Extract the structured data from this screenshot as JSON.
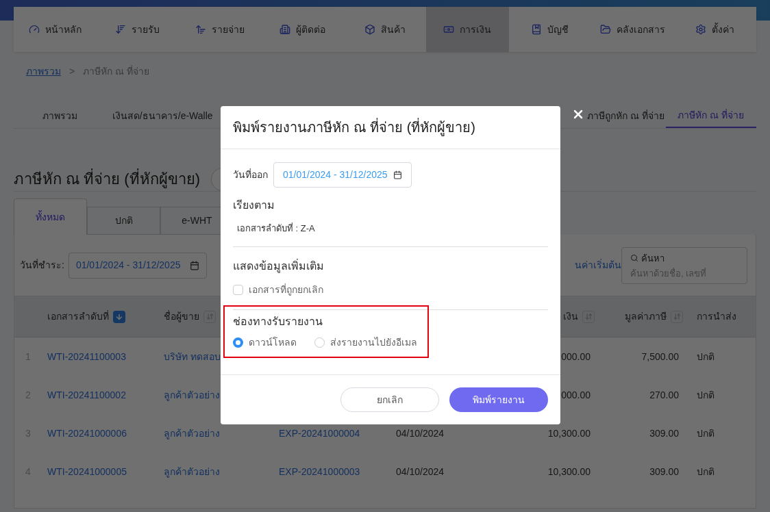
{
  "top_nav": [
    {
      "label": "หน้าหลัก",
      "selected": false
    },
    {
      "label": "รายรับ",
      "selected": false
    },
    {
      "label": "รายจ่าย",
      "selected": false
    },
    {
      "label": "ผู้ติดต่อ",
      "selected": false
    },
    {
      "label": "สินค้า",
      "selected": false
    },
    {
      "label": "การเงิน",
      "selected": true
    },
    {
      "label": "บัญชี",
      "selected": false
    },
    {
      "label": "คลังเอกสาร",
      "selected": false
    },
    {
      "label": "ตั้งค่า",
      "selected": false
    }
  ],
  "breadcrumb": {
    "link": "ภาพรวม",
    "separator": ">",
    "current": "ภาษีหัก ณ ที่จ่าย"
  },
  "sub_tabs": [
    {
      "label": "ภาพรวม",
      "selected": false
    },
    {
      "label": "เงินสด/ธนาคาร/e-Walle",
      "selected": false
    },
    {
      "label": "ภาษีถูกหัก ณ ที่จ่าย",
      "selected": false
    },
    {
      "label": "ภาษีหัก ณ ที่จ่าย",
      "selected": true
    }
  ],
  "page_title": "ภาษีหัก ณ ที่จ่าย (ที่หักผู้ขาย)",
  "card_tabs": [
    {
      "label": "ทั้งหมด",
      "selected": true
    },
    {
      "label": "ปกติ",
      "selected": false
    },
    {
      "label": "e-WHT",
      "selected": false
    }
  ],
  "filter": {
    "label": "วันที่ชำระ:",
    "date_range": "01/01/2024 - 31/12/2025",
    "reset_link": "นค่าเริ่มต้น",
    "search_label": "ค้นหา",
    "search_placeholder": "ค้นหาด้วยชื่อ, เลขที่"
  },
  "table": {
    "columns": [
      {},
      {
        "label": "เอกสารลำดับที่",
        "sort_active": true
      },
      {
        "label": "ชื่อผู้ขาย",
        "sort_active": false
      },
      {},
      {},
      {
        "label": "เงิน",
        "sort_active": false
      },
      {
        "label": "มูลค่าภาษี",
        "sort_active": false
      },
      {
        "label": "การนำส่ง"
      }
    ],
    "rows": [
      {
        "no": "1",
        "doc": "WTI-20241100003",
        "seller": "บริษัท ทดสอบ",
        "amount": "000.00",
        "tax": "7,500.00",
        "status": "ปกติ"
      },
      {
        "no": "2",
        "doc": "WTI-20241100002",
        "seller": "ลูกค้าตัวอย่าง",
        "amount": "000.00",
        "tax": "270.00",
        "status": "ปกติ"
      },
      {
        "no": "3",
        "doc": "WTI-20241000006",
        "seller": "ลูกค้าตัวอย่าง",
        "ref": "EXP-20241000004",
        "date": "04/10/2024",
        "amount": "10,300.00",
        "tax": "309.00",
        "status": "ปกติ"
      },
      {
        "no": "4",
        "doc": "WTI-20241000005",
        "seller": "ลูกค้าตัวอย่าง",
        "ref": "EXP-20241000003",
        "date": "04/10/2024",
        "amount": "10,300.00",
        "tax": "309.00",
        "status": "ปกติ"
      }
    ]
  },
  "dialog": {
    "title": "พิมพ์รายงานภาษีหัก ณ ที่จ่าย (ที่หักผู้ขาย)",
    "date_label": "วันที่ออก",
    "date_range": "01/01/2024 - 31/12/2025",
    "sort_heading": "เรียงตาม",
    "sort_value": "เอกสารลำดับที่ : Z-A",
    "extra_heading": "แสดงข้อมูลเพิ่มเติม",
    "extra_options": [
      {
        "label": "เอกสารที่ถูกยกเลิก",
        "checked": false
      }
    ],
    "channel_heading": "ช่องทางรับรายงาน",
    "channel_highlighted": true,
    "channels": [
      {
        "label": "ดาวน์โหลด",
        "selected": true
      },
      {
        "label": "ส่งรายงานไปยังอีเมล",
        "selected": false
      }
    ],
    "buttons": [
      {
        "label": "ยกเลิก",
        "kind": "secondary"
      },
      {
        "label": "พิมพ์รายงาน",
        "kind": "primary"
      }
    ]
  }
}
